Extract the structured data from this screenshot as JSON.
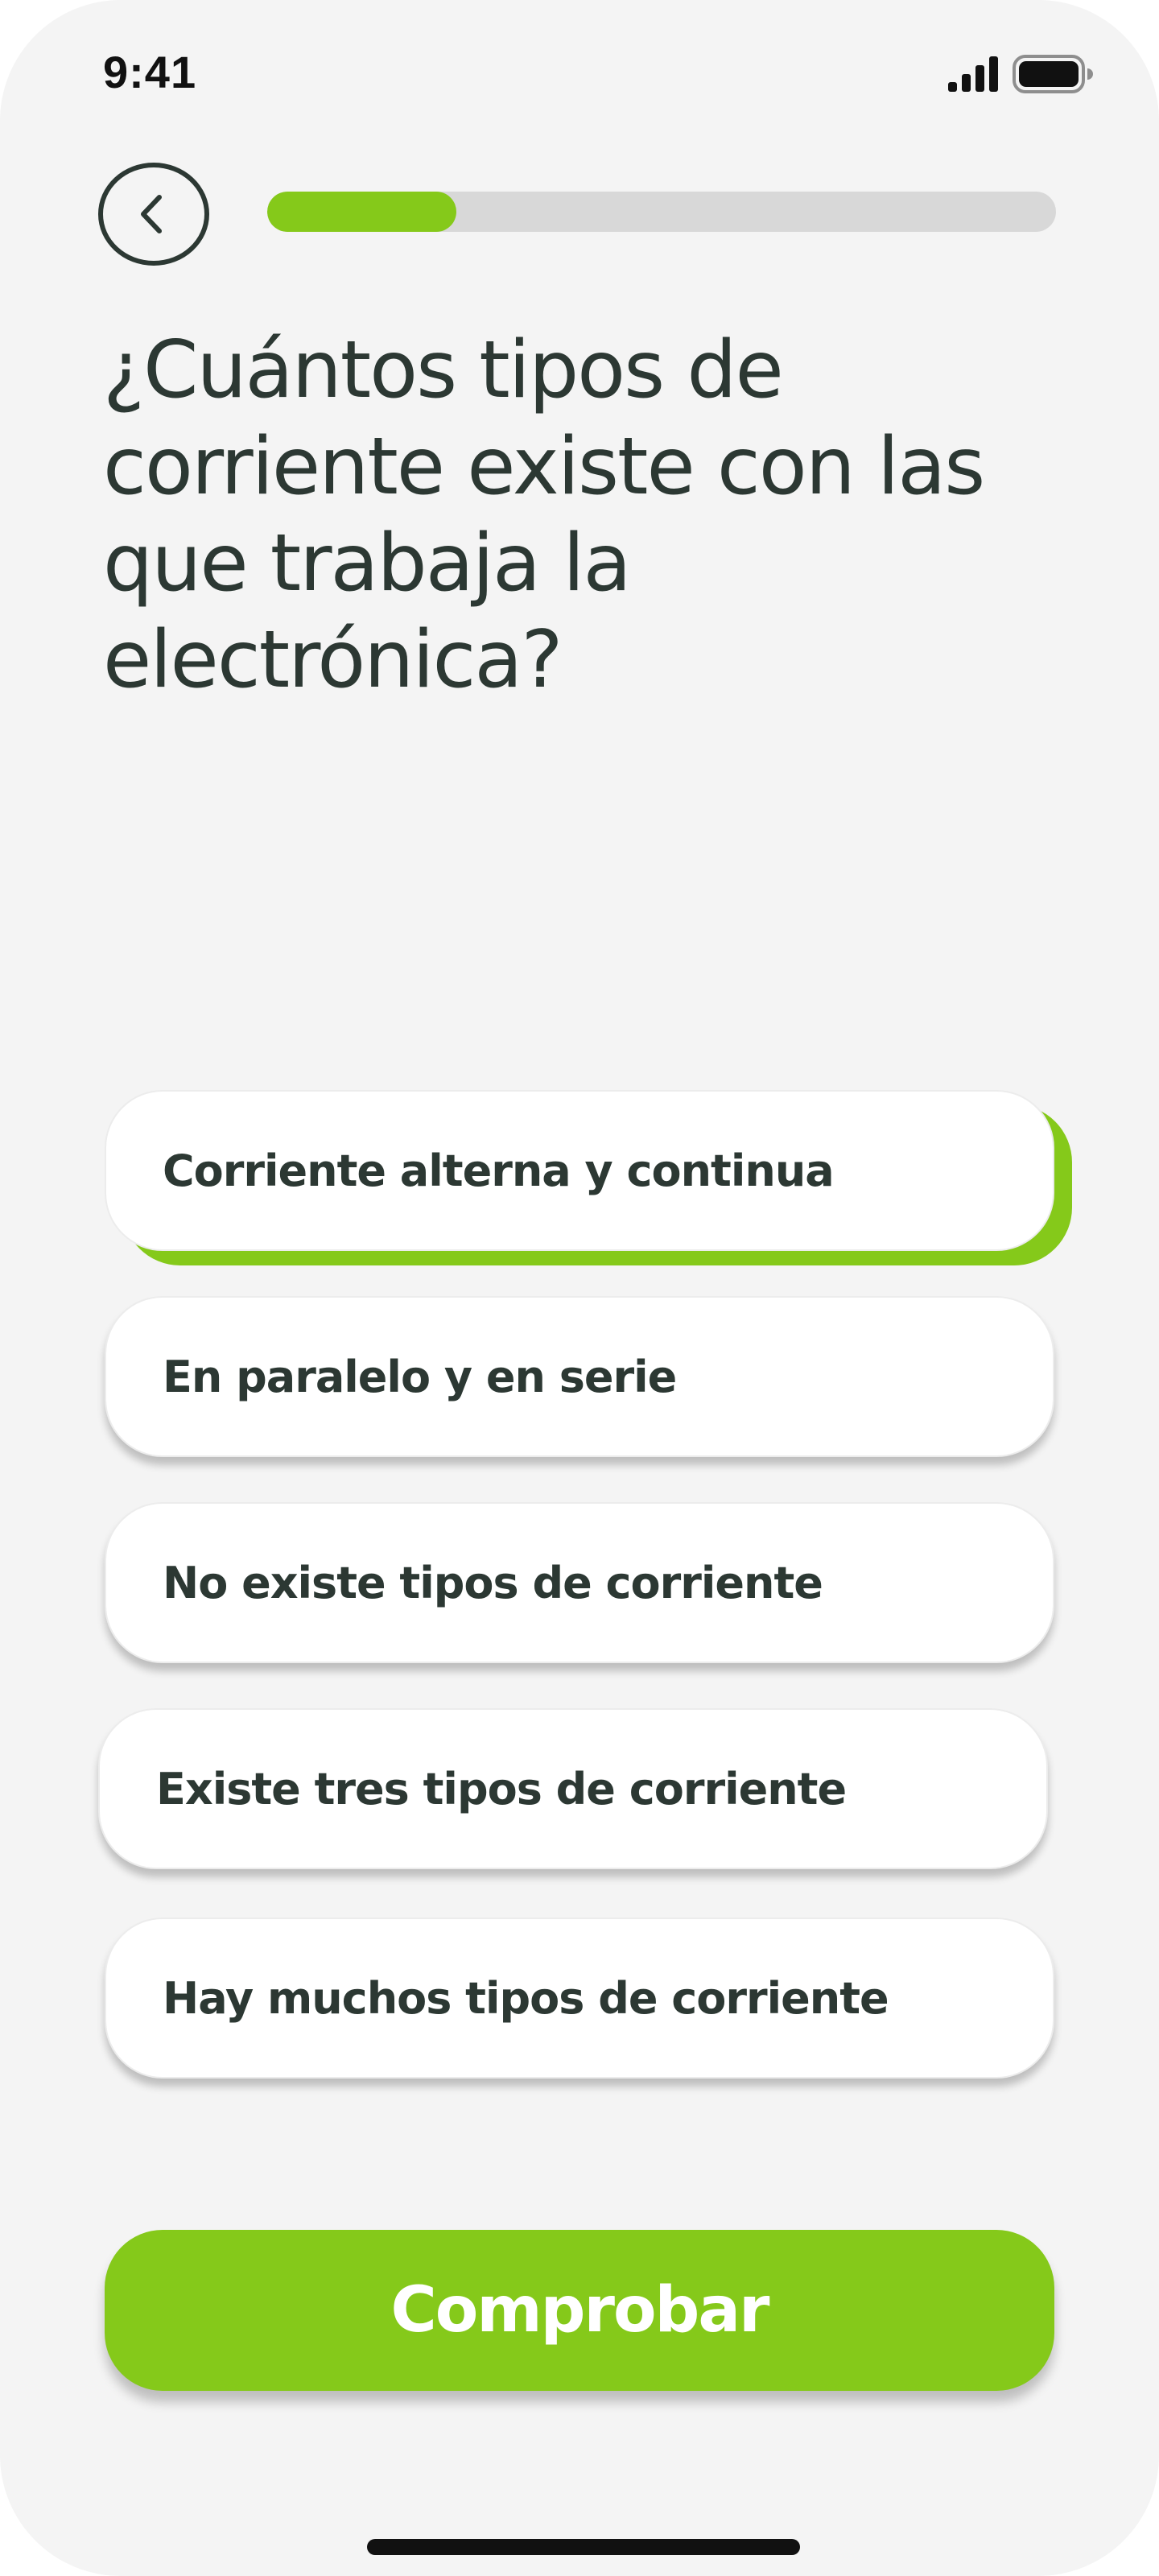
{
  "status_bar": {
    "time": "9:41",
    "signal_icon": "cellular-signal-icon",
    "battery_icon": "battery-full-icon"
  },
  "header": {
    "back_icon": "chevron-left-icon",
    "progress_fraction": 0.24,
    "progress_color": "#85c91a",
    "track_color": "#d8d8d8"
  },
  "question": {
    "text": "¿Cuántos tipos de corriente existe con las que trabaja la electrónica?"
  },
  "options": [
    {
      "label": "Corriente alterna y continua",
      "selected": true
    },
    {
      "label": "En paralelo y en serie",
      "selected": false
    },
    {
      "label": "No existe tipos de corriente",
      "selected": false
    },
    {
      "label": "Existe tres tipos de corriente",
      "selected": false
    },
    {
      "label": "Hay muchos tipos de corriente",
      "selected": false
    }
  ],
  "actions": {
    "check_label": "Comprobar"
  },
  "colors": {
    "accent": "#85c91a",
    "text": "#2c3833",
    "background": "#f4f4f4"
  }
}
